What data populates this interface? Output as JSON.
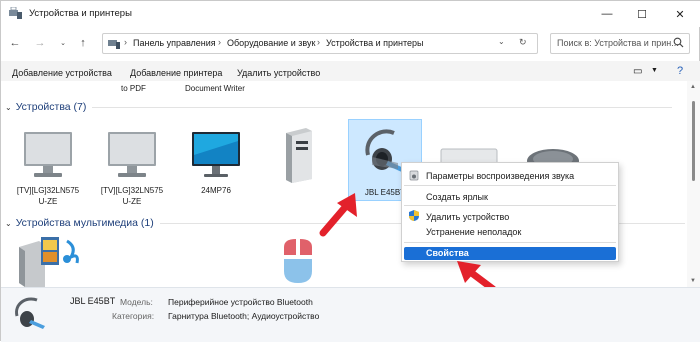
{
  "window": {
    "title": "Устройства и принтеры"
  },
  "address": {
    "crumbs": [
      "Панель управления",
      "Оборудование и звук",
      "Устройства и принтеры"
    ]
  },
  "search": {
    "placeholder": "Поиск в: Устройства и прин..."
  },
  "toolbar": {
    "add_device": "Добавление устройства",
    "add_printer": "Добавление принтера",
    "remove_device": "Удалить устройство"
  },
  "partial_labels": [
    "to PDF",
    "Document Writer"
  ],
  "groups": {
    "devices": "Устройства (7)",
    "multimedia": "Устройства мультимедиа (1)"
  },
  "devices": [
    {
      "label": "[TV][LG]32LN575 U-ZE",
      "icon": "tv-monitor-icon"
    },
    {
      "label": "[TV][LG]32LN575 U-ZE",
      "icon": "tv-monitor-icon"
    },
    {
      "label": "24MP76",
      "icon": "monitor-icon"
    },
    {
      "label": "",
      "icon": "computer-tower-icon"
    },
    {
      "label": "JBL E45BT",
      "icon": "headset-icon"
    },
    {
      "label": "",
      "icon": "keyboard-icon"
    },
    {
      "label": "",
      "icon": "mouse-icon"
    }
  ],
  "context_menu": {
    "items": [
      "Параметры воспроизведения звука",
      "Создать ярлык",
      "Удалить устройство",
      "Устранение неполадок"
    ],
    "highlighted": "Свойства"
  },
  "details": {
    "name": "JBL E45BT",
    "model_key": "Модель:",
    "model_val": "Периферийное устройство Bluetooth",
    "category_key": "Категория:",
    "category_val": "Гарнитура Bluetooth; Аудиоустройство"
  },
  "colors": {
    "accent": "#1a6fd6",
    "arrow": "#e3212b",
    "selection": "#cde8ff",
    "group_text": "#1e3f7a"
  }
}
